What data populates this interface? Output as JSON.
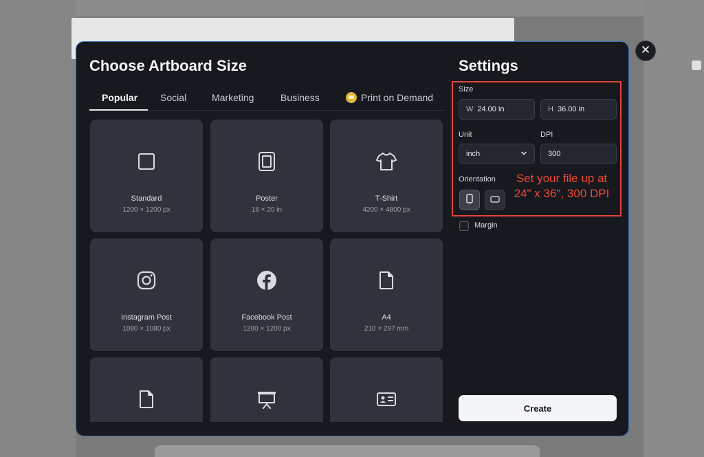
{
  "dialog": {
    "title": "Choose Artboard Size",
    "tabs": [
      {
        "label": "Popular"
      },
      {
        "label": "Social"
      },
      {
        "label": "Marketing"
      },
      {
        "label": "Business"
      },
      {
        "label": "Print on Demand"
      }
    ],
    "cards": [
      {
        "name": "Standard",
        "dims": "1200 × 1200 px",
        "icon": "square-icon"
      },
      {
        "name": "Poster",
        "dims": "16 × 20 in",
        "icon": "poster-icon"
      },
      {
        "name": "T-Shirt",
        "dims": "4200 × 4800 px",
        "icon": "tshirt-icon"
      },
      {
        "name": "Instagram Post",
        "dims": "1080 × 1080 px",
        "icon": "instagram-icon"
      },
      {
        "name": "Facebook Post",
        "dims": "1200 × 1200 px",
        "icon": "facebook-icon"
      },
      {
        "name": "A4",
        "dims": "210 × 297 mm",
        "icon": "document-icon"
      },
      {
        "name": "",
        "dims": "",
        "icon": "document-icon"
      },
      {
        "name": "",
        "dims": "",
        "icon": "presentation-icon"
      },
      {
        "name": "",
        "dims": "",
        "icon": "id-card-icon"
      }
    ]
  },
  "settings": {
    "title": "Settings",
    "size_label": "Size",
    "width_prefix": "W",
    "width_value": "24.00 in",
    "height_prefix": "H",
    "height_value": "36.00 in",
    "unit_label": "Unit",
    "unit_value": "inch",
    "dpi_label": "DPI",
    "dpi_value": "300",
    "orientation_label": "Orientation",
    "orientation_selected": "portrait",
    "margin_label": "Margin",
    "margin_checked": false,
    "create_label": "Create"
  },
  "annotation": {
    "line1": "Set your file up at",
    "line2": "24\" x 36\", 300 DPI",
    "color": "#f0473c"
  },
  "colors": {
    "modal_bg": "#17191e",
    "card_bg": "#30333b",
    "modal_border": "#3c6fb5",
    "highlight": "#e2453b"
  }
}
